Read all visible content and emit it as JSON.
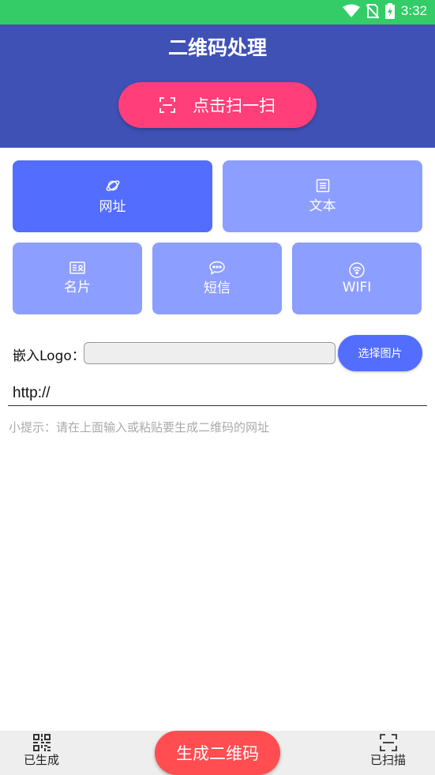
{
  "status_bar": {
    "time": "3:32",
    "icons": [
      "wifi-icon",
      "no-sim-icon",
      "battery-charging-icon"
    ]
  },
  "header": {
    "title": "二维码处理",
    "scan_button": "点击扫一扫"
  },
  "types": {
    "url": "网址",
    "text": "文本",
    "card": "名片",
    "sms": "短信",
    "wifi": "WIFI"
  },
  "logo": {
    "label": "嵌入Logo：",
    "input_value": "",
    "pick_button": "选择图片"
  },
  "content_input": {
    "value": "http://"
  },
  "hint": "小提示：请在上面输入或粘贴要生成二维码的网址",
  "bottom_nav": {
    "generated": "已生成",
    "generate_button": "生成二维码",
    "scanned": "已扫描"
  },
  "colors": {
    "status_bar": "#33cc66",
    "header": "#3f51b5",
    "scan_button": "#ff3e7a",
    "tile_active": "#536dfe",
    "tile": "#8c9eff",
    "generate_button": "#ff4d52"
  }
}
